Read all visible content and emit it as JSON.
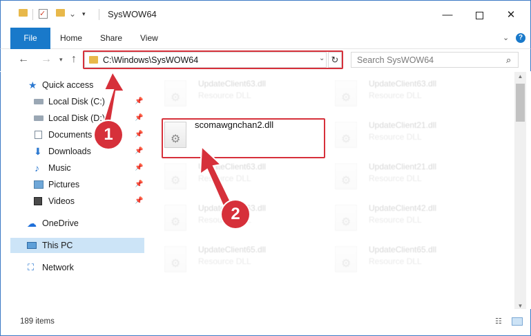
{
  "window": {
    "title": "SysWOW64",
    "minimize_glyph": "—",
    "close_glyph": "✕",
    "check_glyph": "✓",
    "drop_glyph": "▾"
  },
  "ribbon": {
    "tabs": [
      "File",
      "Home",
      "Share",
      "View"
    ],
    "help_glyph": "?",
    "chevron_glyph": "⌄",
    "file_bg": "#1979ca"
  },
  "nav": {
    "back_glyph": "←",
    "forward_glyph": "→",
    "recent_glyph": "▾",
    "up_glyph": "↑",
    "address": "C:\\Windows\\SysWOW64",
    "address_drop_glyph": "⌄",
    "refresh_glyph": "↻",
    "search_placeholder": "Search SysWOW64",
    "search_glyph": "⌕"
  },
  "sidebar": {
    "quick_access": "Quick access",
    "pin_glyph": "📌",
    "pinned": [
      {
        "label": "Local Disk (C:)",
        "icon": "local-disk-icon"
      },
      {
        "label": "Local Disk (D:)",
        "icon": "local-disk-icon"
      },
      {
        "label": "Documents",
        "icon": "documents-icon"
      },
      {
        "label": "Downloads",
        "icon": "downloads-icon"
      },
      {
        "label": "Music",
        "icon": "music-icon"
      },
      {
        "label": "Pictures",
        "icon": "pictures-icon"
      },
      {
        "label": "Videos",
        "icon": "videos-icon"
      }
    ],
    "onedrive": "OneDrive",
    "this_pc": "This PC",
    "network": "Network",
    "glyphs": {
      "star": "★",
      "down": "⬇",
      "music": "♪",
      "cloud": "☁",
      "net": "⛶"
    }
  },
  "files": {
    "main": {
      "name": "scomawgnchan2.dll"
    },
    "faded": [
      {
        "name": "UpdateClient63.dll",
        "type": "Resource DLL"
      },
      {
        "name": "UpdateClient63.dll",
        "type": "Resource DLL"
      },
      {
        "name": "UpdateClient21.dll",
        "type": "Resource DLL"
      },
      {
        "name": "UpdateClient63.dll",
        "type": "Resource DLL"
      },
      {
        "name": "UpdateClient21.dll",
        "type": "Resource DLL"
      },
      {
        "name": "UpdateClient63.dll",
        "type": "Resource DLL"
      },
      {
        "name": "UpdateClient42.dll",
        "type": "Resource DLL"
      },
      {
        "name": "UpdateClient65.dll",
        "type": "Resource DLL"
      },
      {
        "name": "UpdateClient65.dll",
        "type": "Resource DLL"
      }
    ],
    "gear_glyph": "⚙"
  },
  "scrollbar": {
    "up_glyph": "▲",
    "down_glyph": "▼"
  },
  "status": {
    "count": "189 items",
    "details_glyph": "☷"
  },
  "annotations": {
    "step1": "1",
    "step2": "2",
    "color": "#d6303a"
  }
}
